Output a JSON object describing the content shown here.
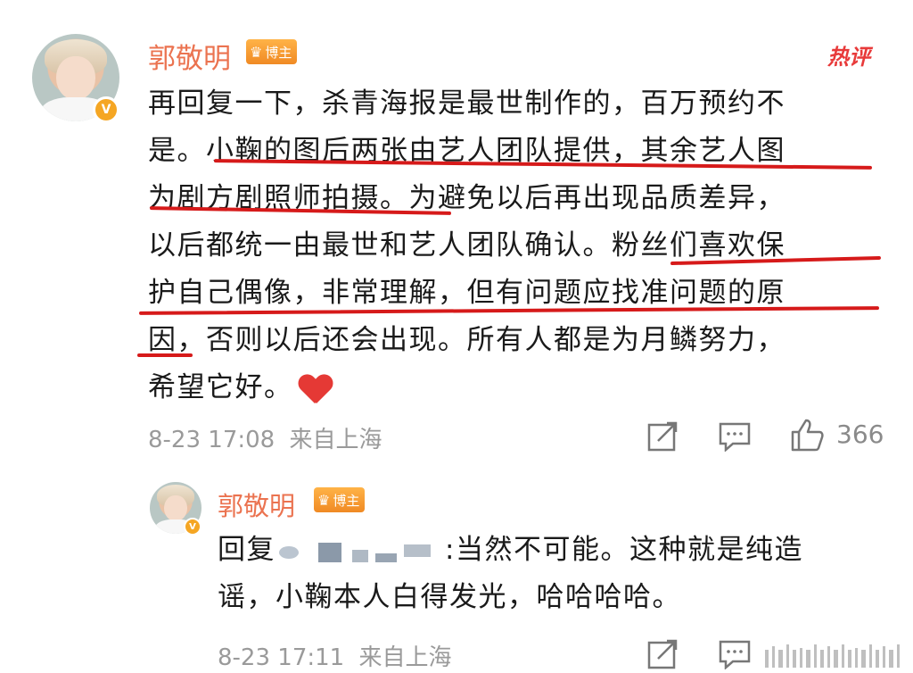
{
  "post": {
    "author": "郭敬明",
    "badge_label": "博主",
    "hot_label": "热评",
    "lines": [
      "再回复一下，杀青海报是最世制作的，百万预约不",
      "是。小鞠的图后两张由艺人团队提供，其余艺人图",
      "为剧方剧照师拍摄。为避免以后再出现品质差异，",
      "以后都统一由最世和艺人团队确认。粉丝们喜欢保",
      "护自己偶像，非常理解，但有问题应找准问题的原",
      "因，否则以后还会出现。所有人都是为月鳞努力，",
      "希望它好。"
    ],
    "time": "8-23 17:08",
    "source": "来自上海",
    "like_count": "366",
    "icons": [
      "share-icon",
      "comment-icon",
      "like-icon",
      "heart-emoji-icon",
      "verified-v-icon",
      "crown-icon"
    ]
  },
  "reply": {
    "author": "郭敬明",
    "badge_label": "博主",
    "prefix": "回复",
    "separator": ":",
    "lines": [
      "当然不可能。这种就是纯造",
      "谣，小鞠本人白得发光，哈哈哈哈。"
    ],
    "time": "8-23 17:11",
    "source": "来自上海",
    "icons": [
      "share-icon",
      "comment-icon"
    ]
  },
  "colors": {
    "name": "#eb7350",
    "underline": "#d61a1a",
    "meta": "#9a9a9a",
    "hot": "#e83a3a",
    "badge": "#f5a623"
  }
}
